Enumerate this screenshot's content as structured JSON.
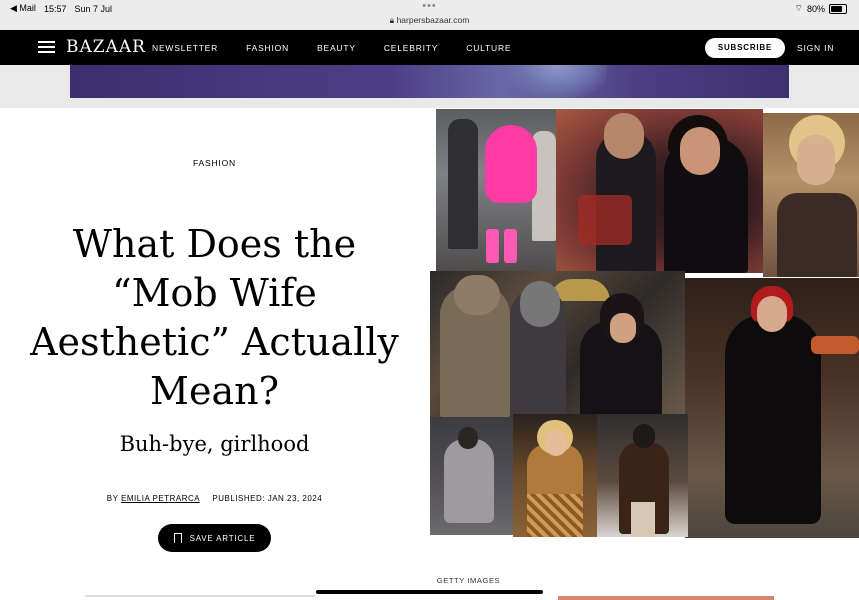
{
  "status_bar": {
    "back_app": "◀ Mail",
    "time": "15:57",
    "date": "Sun 7 Jul",
    "url": "harpersbazaar.com",
    "battery": "80%"
  },
  "nav": {
    "logo": "BAZAAR",
    "links": [
      "NEWSLETTER",
      "FASHION",
      "BEAUTY",
      "CELEBRITY",
      "CULTURE"
    ],
    "subscribe": "SUBSCRIBE",
    "sign_in": "SIGN IN"
  },
  "article": {
    "category": "FASHION",
    "title": "What Does the “Mob Wife Aesthetic” Actually Mean?",
    "dek": "Buh-bye, girlhood",
    "byline_prefix": "BY",
    "author": "EMILIA PETRARCA",
    "published": "PUBLISHED: JAN 23, 2024",
    "save_label": "SAVE ARTICLE"
  },
  "image_credit": "GETTY IMAGES",
  "colors": {
    "nav_bg": "#000000",
    "accent_pink": "#ff3aa3",
    "page_bg": "#ffffff"
  }
}
